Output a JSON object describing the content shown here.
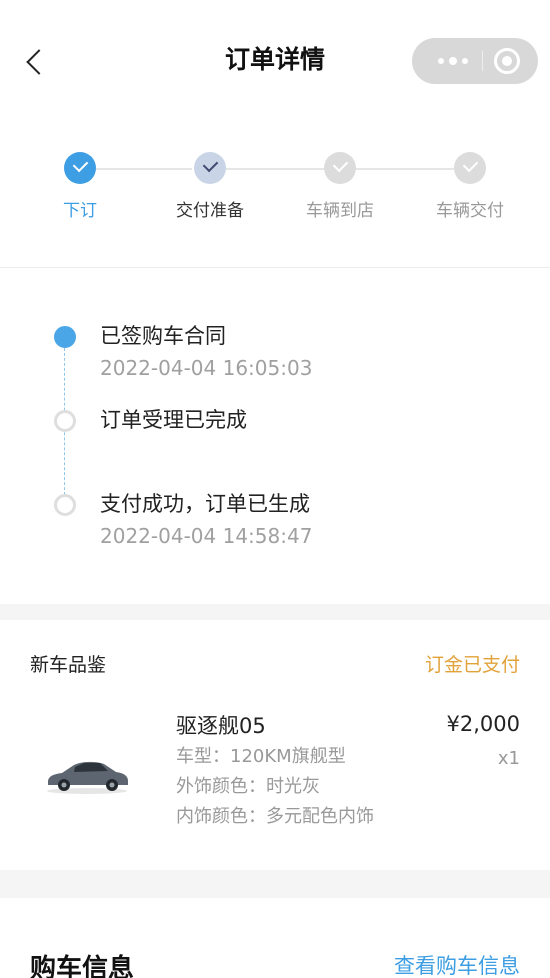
{
  "header": {
    "title": "订单详情"
  },
  "steps": [
    {
      "label": "下订",
      "state": "done"
    },
    {
      "label": "交付准备",
      "state": "current"
    },
    {
      "label": "车辆到店",
      "state": "todo"
    },
    {
      "label": "车辆交付",
      "state": "todo"
    }
  ],
  "timeline": [
    {
      "text": "已签购车合同",
      "time": "2022-04-04 16:05:03"
    },
    {
      "text": "订单受理已完成",
      "time": ""
    },
    {
      "text": "支付成功，订单已生成",
      "time": "2022-04-04 14:58:47"
    }
  ],
  "order": {
    "section_title": "新车品鉴",
    "status": "订金已支付",
    "product_name": "驱逐舰05",
    "model": "车型：120KM旗舰型",
    "exterior": "外饰颜色：时光灰",
    "interior": "内饰颜色：多元配色内饰",
    "price": "¥2,000",
    "quantity": "x1"
  },
  "purchase": {
    "title": "购车信息",
    "link": "查看购车信息"
  },
  "colors": {
    "accent": "#3d9ee3",
    "status": "#e2a23a"
  }
}
